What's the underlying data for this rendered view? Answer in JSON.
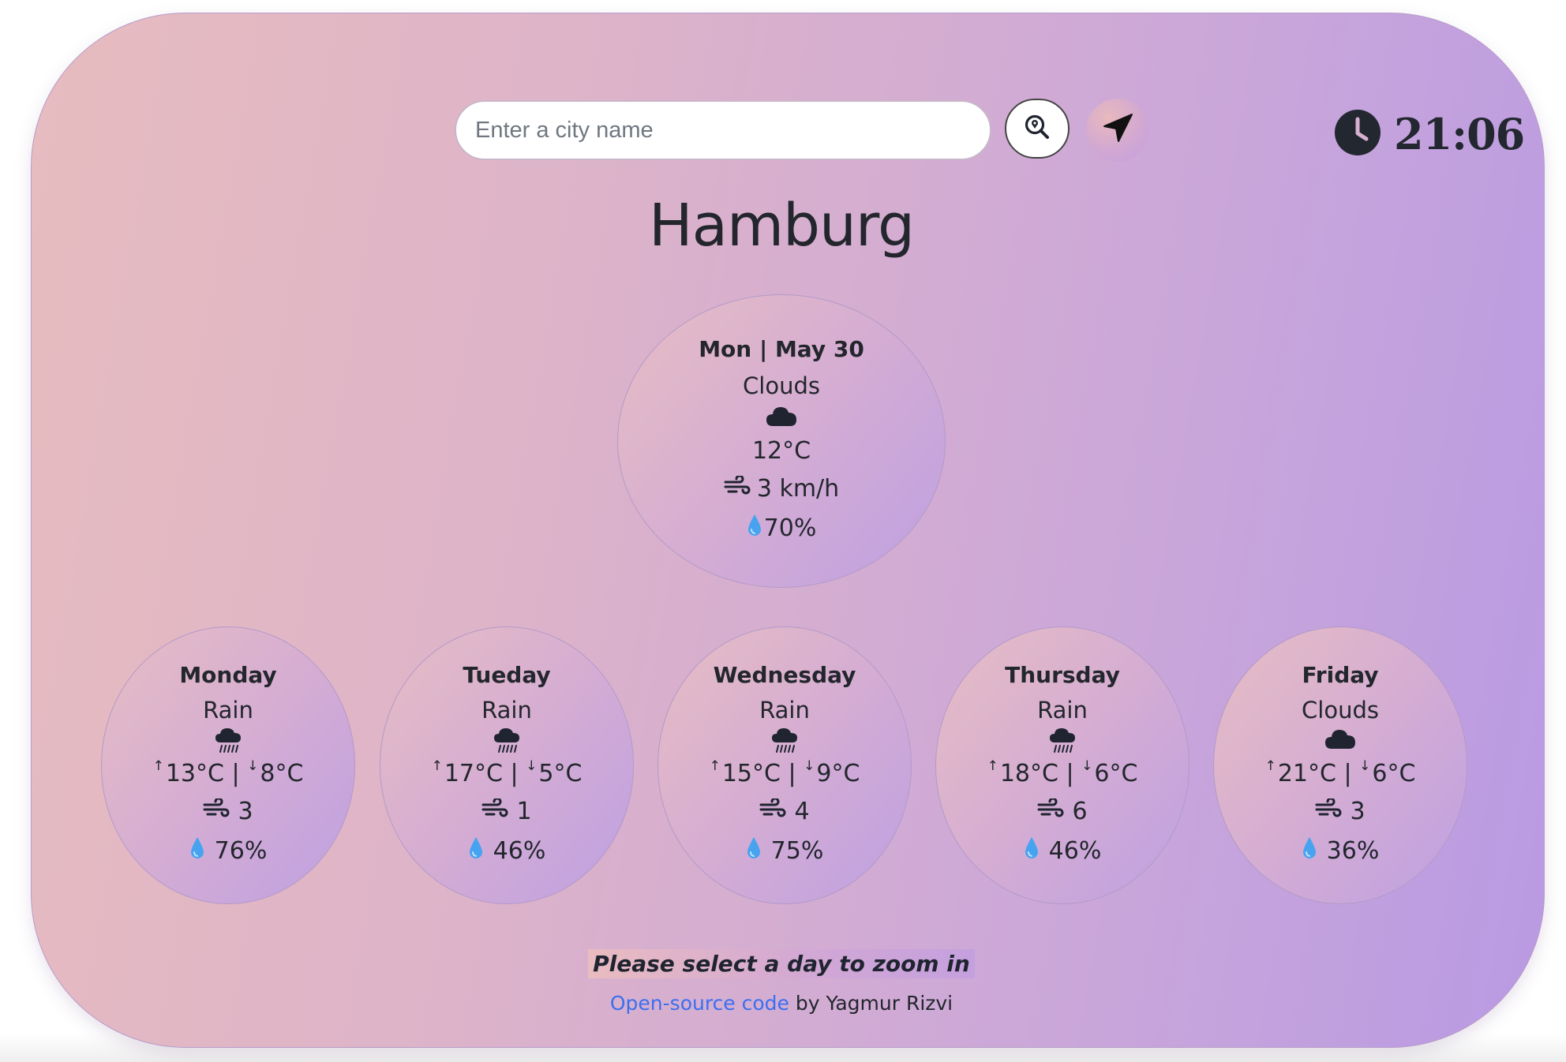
{
  "search": {
    "placeholder": "Enter a city name",
    "value": ""
  },
  "icons": {
    "search": "search-location-icon",
    "locate": "location-arrow-icon",
    "clock": "clock-icon",
    "wind": "wind-icon",
    "humidity": "water-drop-icon",
    "clouds": "cloud-icon",
    "rain": "cloud-rain-icon"
  },
  "clock": {
    "time": "21:06"
  },
  "city": "Hamburg",
  "current": {
    "date": "Mon | May 30",
    "condition": "Clouds",
    "icon": "cloud-icon",
    "temperature": "12°C",
    "wind": "3 km/h",
    "humidity": "70%"
  },
  "forecast": [
    {
      "day": "Monday",
      "condition": "Rain",
      "icon": "cloud-rain-icon",
      "high": "13°C",
      "low": "8°C",
      "wind": "3",
      "humidity": "76%"
    },
    {
      "day": "Tueday",
      "condition": "Rain",
      "icon": "cloud-rain-icon",
      "high": "17°C",
      "low": "5°C",
      "wind": "1",
      "humidity": "46%"
    },
    {
      "day": "Wednesday",
      "condition": "Rain",
      "icon": "cloud-rain-icon",
      "high": "15°C",
      "low": "9°C",
      "wind": "4",
      "humidity": "75%"
    },
    {
      "day": "Thursday",
      "condition": "Rain",
      "icon": "cloud-rain-icon",
      "high": "18°C",
      "low": "6°C",
      "wind": "6",
      "humidity": "46%"
    },
    {
      "day": "Friday",
      "condition": "Clouds",
      "icon": "cloud-icon",
      "high": "21°C",
      "low": "6°C",
      "wind": "3",
      "humidity": "36%"
    }
  ],
  "hint": "Please select a day to zoom in",
  "footer": {
    "link_text": "Open-source code",
    "by_text": "by Yagmur Rizvi"
  },
  "colors": {
    "gradient_start": "#e7bcbf",
    "gradient_end": "#b99ae3",
    "link": "#3b6ff0",
    "text": "#23262d"
  }
}
